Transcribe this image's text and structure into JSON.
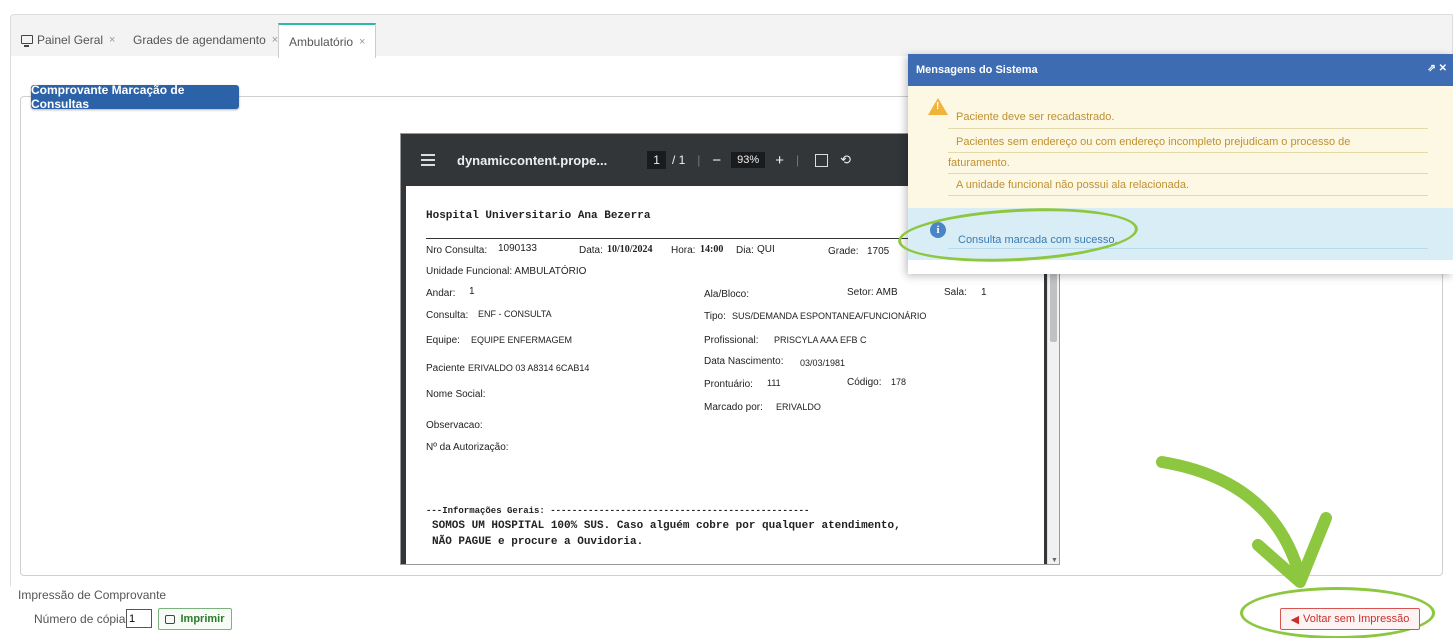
{
  "tabs": [
    {
      "label": "Painel Geral",
      "close": "×"
    },
    {
      "label": "Grades de agendamento",
      "close": "×"
    },
    {
      "label": "Ambulatório",
      "close": "×"
    }
  ],
  "section": {
    "title": "Comprovante Marcação de Consultas"
  },
  "pdf": {
    "filename": "dynamiccontent.prope...",
    "page_current": "1",
    "page_total": "/ 1",
    "zoom": "93%",
    "minus": "−",
    "plus": "+",
    "rotate": "⟲"
  },
  "doc": {
    "hospital": "Hospital Universitario Ana Bezerra",
    "nro_label": "Nro Consulta:",
    "nro_value": "1090133",
    "data_label": "Data:",
    "data_value": "10/10/2024",
    "hora_label": "Hora:",
    "hora_value": "14:00",
    "dia_label": "Dia:",
    "dia_value": "QUI",
    "grade_label": "Grade:",
    "grade_value": "1705",
    "unidade": "Unidade Funcional: AMBULATÓRIO",
    "andar_label": "Andar:",
    "andar_value": "1",
    "ala_label": "Ala/Bloco:",
    "setor_label": "Setor:",
    "setor_value": "AMB",
    "sala_label": "Sala:",
    "sala_value": "1",
    "consulta_label": "Consulta:",
    "consulta_value": "ENF - CONSULTA",
    "tipo_label": "Tipo:",
    "tipo_value": "SUS/DEMANDA ESPONTANEA/FUNCIONÁRIO",
    "equipe_label": "Equipe:",
    "equipe_value": "EQUIPE ENFERMAGEM",
    "prof_label": "Profissional:",
    "prof_value": "PRISCYLA AAA EFB C",
    "paciente_label": "Paciente",
    "paciente_value": "ERIVALDO 03 A8314 6CAB14",
    "nasc_label": "Data Nascimento:",
    "nasc_value": "03/03/1981",
    "pront_label": "Prontuário:",
    "pront_value": "111",
    "codigo_label": "Código:",
    "codigo_value": "178",
    "nome_social": "Nome Social:",
    "marcado_label": "Marcado por:",
    "marcado_value": "ERIVALDO",
    "obs": "Observacao:",
    "autorizacao": "Nº da Autorização:",
    "info_header": "---Informações Gerais: ------------------------------------------------",
    "info_line1": "SOMOS UM HOSPITAL 100% SUS. Caso alguém cobre por qualquer atendimento,",
    "info_line2": "NÃO PAGUE e procure a Ouvidoria."
  },
  "messages": {
    "title": "Mensagens do Sistema",
    "header_icons": "⇗ ✕",
    "warnings": [
      "Paciente deve ser recadastrado.",
      "Pacientes sem endereço ou com endereço incompleto prejudicam o processo de",
      "faturamento.",
      "A unidade funcional não possui ala relacionada."
    ],
    "info": "Consulta marcada com sucesso."
  },
  "footer": {
    "section_label": "Impressão de Comprovante",
    "copies_label": "Número de cópias",
    "copies_value": "1",
    "print_label": "Imprimir",
    "back_label": "Voltar sem Impressão"
  },
  "colors": {
    "primary": "#2c63a8",
    "annotation_green": "#8dc63f",
    "warning_bg": "#fcf8e3",
    "info_bg": "#d9edf7",
    "danger": "#c9302c"
  }
}
